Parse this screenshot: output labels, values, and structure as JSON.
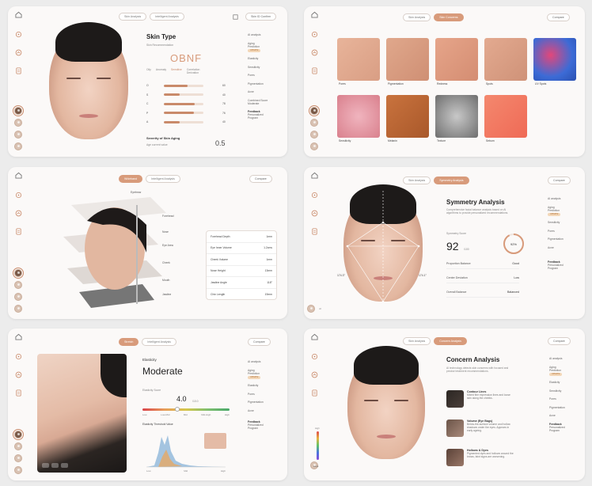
{
  "colors": {
    "accent": "#d89b7b",
    "panel": "#fbf9f8",
    "badge": "#f3d7b8"
  },
  "right_nav": {
    "ai_analysis": "AI analysis",
    "aging": "Aging",
    "prediction": "Prediction",
    "badge": "UPDATE",
    "elasticity": "Elasticity",
    "sensitivity": "Sensitivity",
    "pores": "Pores",
    "pigmentation": "Pigmentation",
    "acne": "Acne",
    "feedback": "Feedback",
    "personalized": "Personalized",
    "program": "Program"
  },
  "panel1": {
    "tabs": [
      "Skin Analysis",
      "Intelligent Analysis"
    ],
    "compare": "Skin ID Confirm",
    "title": "Skin Type",
    "subtitle": "Skin Recommendation",
    "code": "OBNF",
    "legend": [
      "Oily",
      "Anomaly",
      "Sensitive",
      "Correlation Derivation"
    ],
    "metrics": [
      {
        "label": "O",
        "value": 60,
        "display": "60"
      },
      {
        "label": "S",
        "value": 40,
        "display": "40"
      },
      {
        "label": "C",
        "value": 78,
        "display": "78"
      },
      {
        "label": "P",
        "value": 76,
        "display": "76"
      },
      {
        "label": "A",
        "value": 40,
        "display": "40"
      }
    ],
    "severity_title": "Severity of Skin Aging",
    "severity_sub": "Age current value",
    "severity_value": "0.5",
    "extra_nav": [
      "Combined Score",
      "Moderate"
    ]
  },
  "panel2": {
    "tabs": [
      "Skin Analysis",
      "Skin Concerns"
    ],
    "compare": "Compare",
    "thumbs": [
      "Pores",
      "Pigmentation",
      "Redness",
      "Spots",
      "UV Spots",
      "Sensitivity",
      "Melanin",
      "Texture",
      "Sebum"
    ]
  },
  "panel3": {
    "tabs": [
      "Wideband",
      "Intelligent Analysis"
    ],
    "compare": "Compare",
    "labels": [
      "Forehead",
      "Nose",
      "Eye Area",
      "Cheek",
      "Mouth",
      "Jawline",
      "Eyebrow"
    ],
    "metrics": [
      {
        "name": "Forehead Depth",
        "value": "1mm"
      },
      {
        "name": "Eye Inner Volume",
        "value": "1.2cms"
      },
      {
        "name": "Cheek Volume",
        "value": "1mm"
      },
      {
        "name": "Nose Height",
        "value": "13mm"
      },
      {
        "name": "Jawline Angle",
        "value": "118°"
      },
      {
        "name": "Chin Length",
        "value": "19mm"
      }
    ]
  },
  "panel4": {
    "tabs": [
      "Skin Analysis",
      "Symmetry Analysis"
    ],
    "compare": "Compare",
    "title": "Symmetry Analysis",
    "desc": "Comprehensive facial balance analysis based on AI algorithms to provide personalized recommendations.",
    "score_label": "Symmetry Score",
    "score": "92",
    "score_unit": "/100",
    "ring": "92%",
    "ring_value": 92,
    "left_angle": "174.3°",
    "right_angle": "174.1°",
    "rows": [
      {
        "name": "Proportion Balance",
        "value": "Good"
      },
      {
        "name": "Center Deviation",
        "value": "Low"
      },
      {
        "name": "Overall Balance",
        "value": "Balanced"
      }
    ],
    "user_tag": "AI"
  },
  "panel5": {
    "tabs": [
      "Stretch",
      "Intelligent Analysis"
    ],
    "compare": "Compare",
    "title": "Elasticity",
    "level": "Moderate",
    "score_label": "Elasticity Score",
    "score": "4.0",
    "score_unit": "/10.0",
    "scale": [
      "Low",
      "Low-Mid",
      "Mid",
      "Mid-High",
      "High"
    ],
    "scale_position": 0.4,
    "chart_title": "Elasticity Threshold Value",
    "chart_ticks": [
      "Low",
      "Mid",
      "High"
    ]
  },
  "panel6": {
    "tabs": [
      "Skin Analysis",
      "Concern Analysis"
    ],
    "compare": "Compare",
    "title": "Concern Analysis",
    "desc": "AI technology detects skin concerns with focused and precise treatment recommendations.",
    "items": [
      {
        "title": "Contour Lines",
        "desc": "Mixed fine expression lines and loose skin along the cheeks."
      },
      {
        "title": "Volume (Eye Bags)",
        "desc": "Below-the-surface volume and hollow shadows under the eyes. Appears in early ageing."
      },
      {
        "title": "Hollows & Dyes",
        "desc": "Pigmented dyes and hollows around the brows, faint signs are worsening."
      }
    ],
    "scale_top": "High",
    "scale_bottom": "Low",
    "footer": "Less"
  }
}
